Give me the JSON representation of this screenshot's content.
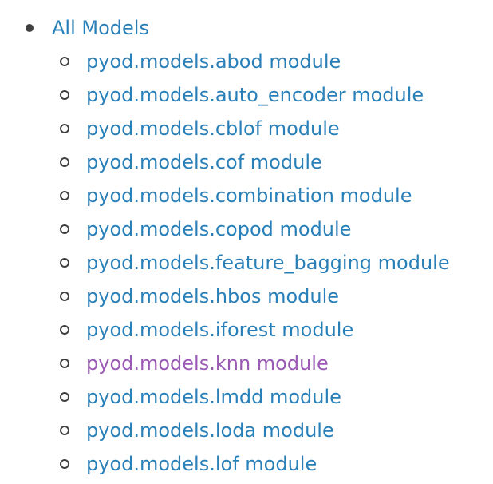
{
  "toc": {
    "root": {
      "label": "All Models",
      "items": [
        {
          "label": "pyod.models.abod module",
          "visited": false
        },
        {
          "label": "pyod.models.auto_encoder module",
          "visited": false
        },
        {
          "label": "pyod.models.cblof module",
          "visited": false
        },
        {
          "label": "pyod.models.cof module",
          "visited": false
        },
        {
          "label": "pyod.models.combination module",
          "visited": false
        },
        {
          "label": "pyod.models.copod module",
          "visited": false
        },
        {
          "label": "pyod.models.feature_bagging module",
          "visited": false
        },
        {
          "label": "pyod.models.hbos module",
          "visited": false
        },
        {
          "label": "pyod.models.iforest module",
          "visited": false
        },
        {
          "label": "pyod.models.knn module",
          "visited": true
        },
        {
          "label": "pyod.models.lmdd module",
          "visited": false
        },
        {
          "label": "pyod.models.loda module",
          "visited": false
        },
        {
          "label": "pyod.models.lof module",
          "visited": false
        }
      ]
    },
    "colors": {
      "link": "#2980b9",
      "visited": "#9b59b6",
      "bullet": "#404040"
    }
  }
}
